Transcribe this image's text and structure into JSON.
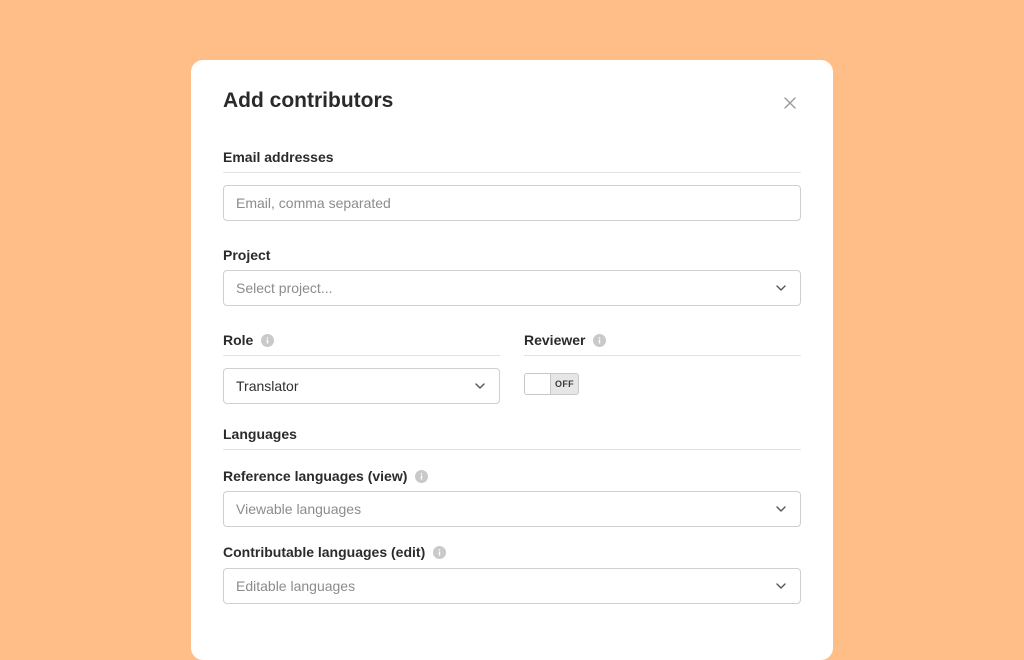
{
  "modal": {
    "title": "Add contributors",
    "close_icon": "close-icon"
  },
  "email": {
    "label": "Email addresses",
    "placeholder": "Email, comma separated",
    "value": ""
  },
  "project": {
    "label": "Project",
    "placeholder": "Select project..."
  },
  "role": {
    "label": "Role",
    "value": "Translator"
  },
  "reviewer": {
    "label": "Reviewer",
    "toggle_text": "OFF"
  },
  "languages": {
    "section_label": "Languages",
    "reference_label": "Reference languages (view)",
    "reference_placeholder": "Viewable languages",
    "contributable_label": "Contributable languages (edit)",
    "contributable_placeholder": "Editable languages"
  },
  "colors": {
    "background": "#FFBD88",
    "card": "#FFFFFF",
    "border": "#CFCFCF",
    "info_icon": "#C9C9C9"
  }
}
